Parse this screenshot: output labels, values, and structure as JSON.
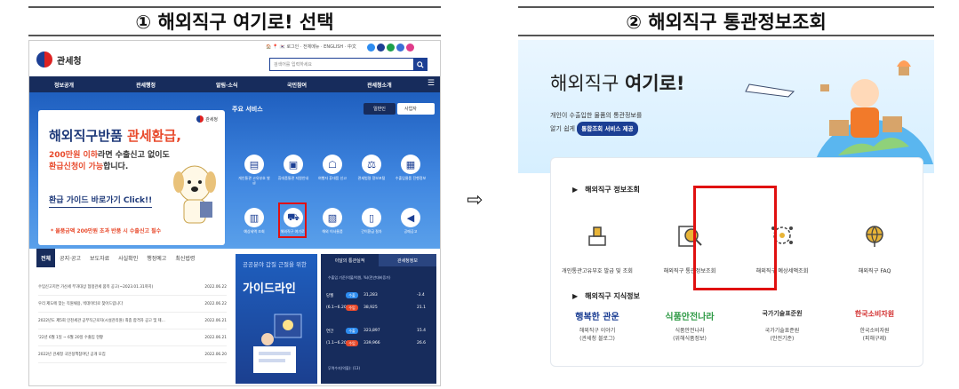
{
  "steps": {
    "step1_title": "① 해외직구 여기로! 선택",
    "step2_title": "② 해외직구 통관정보조회",
    "arrow": "⇨"
  },
  "left_site": {
    "logo_text": "관세청",
    "util_links": "🏠 📍 🇰🇷 로그인 · 전체메뉴 · ENGLISH · 中文",
    "search_placeholder": "검색어를 입력하세요",
    "nav": [
      "정보공개",
      "관세행정",
      "알림·소식",
      "국민참여",
      "관세청소개"
    ],
    "banner": {
      "logo": "관세청",
      "title_plain": "해외직구반품 ",
      "title_highlight": "관세환급,",
      "line1_highlight": "200만원 이하",
      "line1_rest": "라면 수출신고 없이도",
      "line2_highlight": "환급신청이 가능",
      "line2_rest": "합니다.",
      "link": "환급 가이드 바로가기 Click!!",
      "note": "* 물품금액 200만원 초과 반품 시 수출신고 필수"
    },
    "services": {
      "title": "주요 서비스",
      "toggle_active": "일반인",
      "toggle_other": "사업자",
      "items": [
        {
          "label": "개인통관 고유부호 발급",
          "icon": "id-card-icon"
        },
        {
          "label": "휴대품통관 지원안내",
          "icon": "luggage-icon"
        },
        {
          "label": "여행자 휴대품 신고",
          "icon": "passenger-icon"
        },
        {
          "label": "관세법령 정보포털",
          "icon": "law-icon"
        },
        {
          "label": "수출입물품 진행정보",
          "icon": "cargo-icon"
        },
        {
          "label": "예상세액 조회",
          "icon": "calculator-icon"
        },
        {
          "label": "해외직구 여기로!",
          "icon": "cart-icon"
        },
        {
          "label": "해외 이사물품",
          "icon": "box-icon"
        },
        {
          "label": "간이환급 절차",
          "icon": "refund-icon"
        },
        {
          "label": "공매공고",
          "icon": "megaphone-icon"
        }
      ]
    },
    "tabs": [
      "전체",
      "공지·공고",
      "보도자료",
      "사실확인",
      "행정예고",
      "최신법령"
    ],
    "news": [
      {
        "title": "수입신고지연 가산세 부과대상 협정관세 품목 공고(~2023.01.31까지)",
        "date": "2022.06.22"
      },
      {
        "title": "우리 제도에 맞는 직원채용, 빅데이터로 찾아드립니다",
        "date": "2022.06.22"
      },
      {
        "title": "2022년도 제5회 인천세관 공무직근로자(시설관리원) 최종 합격자 공고 및 제…",
        "date": "2022.06.21"
      },
      {
        "title": "'22년 6월 1일 ~ 6월 20일 수출입 현황",
        "date": "2022.06.21"
      },
      {
        "title": "2022년 관세청 국민정책참여단 공개 모집",
        "date": "2022.06.20"
      }
    ],
    "guide": {
      "top": "공공분야 갑질 근절을 위한",
      "title": "가이드라인"
    },
    "trade": {
      "tab_active": "이달의 통관실적",
      "tab_other": "관세청정보",
      "header": "수출입 기준(억불/억원, %)(전년대비증가)",
      "rows": [
        {
          "period": "당월",
          "kind": "수출",
          "amount": "31,283",
          "rate": "-3.4"
        },
        {
          "period": "(6.1~6.20)",
          "kind": "수입",
          "amount": "38,925",
          "rate": "21.1"
        },
        {
          "period": "연간",
          "kind": "수출",
          "amount": "323,897",
          "rate": "15.4"
        },
        {
          "period": "(1.1~6.20)",
          "kind": "수입",
          "amount": "339,966",
          "rate": "26.6"
        }
      ],
      "footer": "무역수지(억불): (13)"
    },
    "colors": {
      "navy": "#172c5c",
      "accent_red": "#e84a2c",
      "highlight_box": "#e01010"
    }
  },
  "right_site": {
    "title_plain": "해외직구 ",
    "title_bold": "여기로!",
    "desc1": "개인이 수출입한 물품의 통관정보를",
    "desc2_prefix": "알기 쉽게",
    "desc2_badge": "통합조회 서비스 제공",
    "section1_title": "해외직구 정보조회",
    "items": [
      {
        "label": "개인통관고유부호 발급 및 조회",
        "icon": "stamp-icon"
      },
      {
        "label": "해외직구 통관정보조회",
        "icon": "magnifier-icon"
      },
      {
        "label": "해외직구 예상세액조회",
        "icon": "network-icon"
      },
      {
        "label": "해외직구 FAQ",
        "icon": "globe-icon"
      }
    ],
    "section2_title": "해외직구 지식정보",
    "knowledge": [
      {
        "logo": "행복한 관운",
        "line1": "해외직구 이야기",
        "line2": "(관세청 블로그)",
        "color": "#1c3f94"
      },
      {
        "logo": "식품안전나라",
        "line1": "식품안전나라",
        "line2": "(위해식품정보)",
        "color": "#2e9a45"
      },
      {
        "logo": "국가기술표준원",
        "line1": "국가기술표준원",
        "line2": "(안전기준)",
        "color": "#333333"
      },
      {
        "logo": "한국소비자원",
        "line1": "한국소비자원",
        "line2": "(피해구제)",
        "color": "#d22d2d"
      }
    ]
  }
}
